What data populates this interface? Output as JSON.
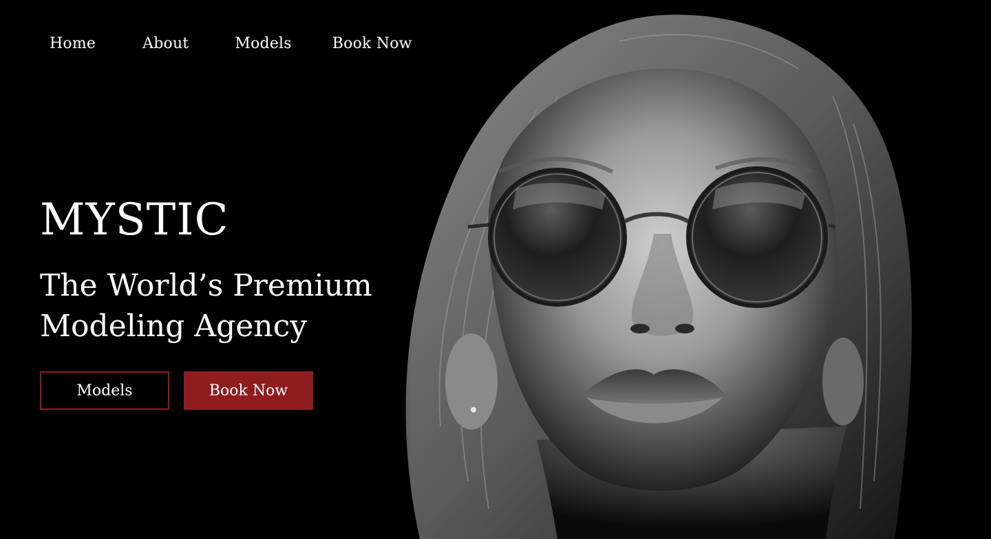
{
  "nav": {
    "items": [
      {
        "label": "Home"
      },
      {
        "label": "About"
      },
      {
        "label": "Models"
      },
      {
        "label": "Book Now"
      }
    ]
  },
  "hero": {
    "brand": "MYSTIC",
    "tagline_line1": "The World’s Premium",
    "tagline_line2": "Modeling Agency",
    "primary_button": "Models",
    "secondary_button": "Book Now",
    "image_subject": "black-and-white portrait of a woman wearing round sunglasses"
  },
  "colors": {
    "background": "#000000",
    "text": "#ffffff",
    "accent": "#8f1d1f"
  }
}
